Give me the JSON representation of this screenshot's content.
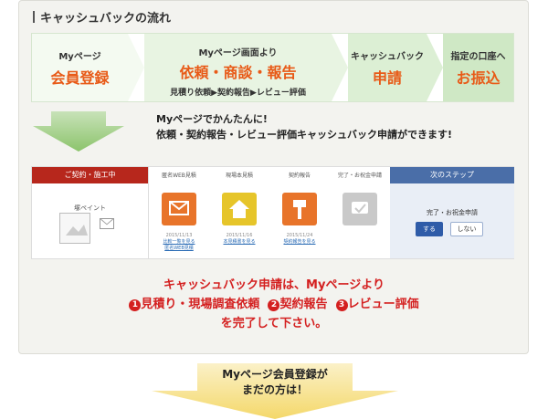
{
  "section_title": "キャッシュバックの流れ",
  "steps": [
    {
      "small": "Myページ",
      "big": "会員登録",
      "sub": ""
    },
    {
      "small": "Myページ画面より",
      "big": "依頼・商談・報告",
      "sub": "見積り依頼▶契約報告▶レビュー評価"
    },
    {
      "small": "キャッシュバック",
      "big": "申請",
      "sub": ""
    },
    {
      "small": "指定の口座へ",
      "big": "お振込",
      "sub": ""
    }
  ],
  "intro": {
    "line1": "Myページでかんたんに!",
    "line2": "依頼・契約報告・レビュー評価キャッシュバック申請ができます!"
  },
  "screen": {
    "left_header": "ご契約・施工中",
    "left_label": "塚ペイント",
    "columns": [
      {
        "head": "匿名WEB見積",
        "date": "2015/11/13",
        "link1": "比較一覧を見る",
        "link2": "匿名WEB見積"
      },
      {
        "head": "現場本見積",
        "date": "2015/11/16",
        "link1": "本見積書を見る",
        "link2": ""
      },
      {
        "head": "契約報告",
        "date": "2015/11/24",
        "link1": "契約報告を見る",
        "link2": ""
      },
      {
        "head": "完了・お祝金申請",
        "date": "",
        "link1": "",
        "link2": ""
      }
    ],
    "right_header": "次のステップ",
    "right_text": "完了・お祝金申請",
    "btn_yes": "する",
    "btn_no": "しない"
  },
  "notice": {
    "line1": "キャッシュバック申請は、Myページより",
    "item1_num": "1",
    "item1": "見積り・現場調査依頼",
    "item2_num": "2",
    "item2": "契約報告",
    "item3_num": "3",
    "item3": "レビュー評価",
    "line3": "を完了して下さい。"
  },
  "bottom": {
    "line1": "Myページ会員登録が",
    "line2": "まだの方は！"
  },
  "colors": {
    "accent": "#e85a17",
    "red": "#d42020",
    "green_step": "#d8eed0"
  }
}
